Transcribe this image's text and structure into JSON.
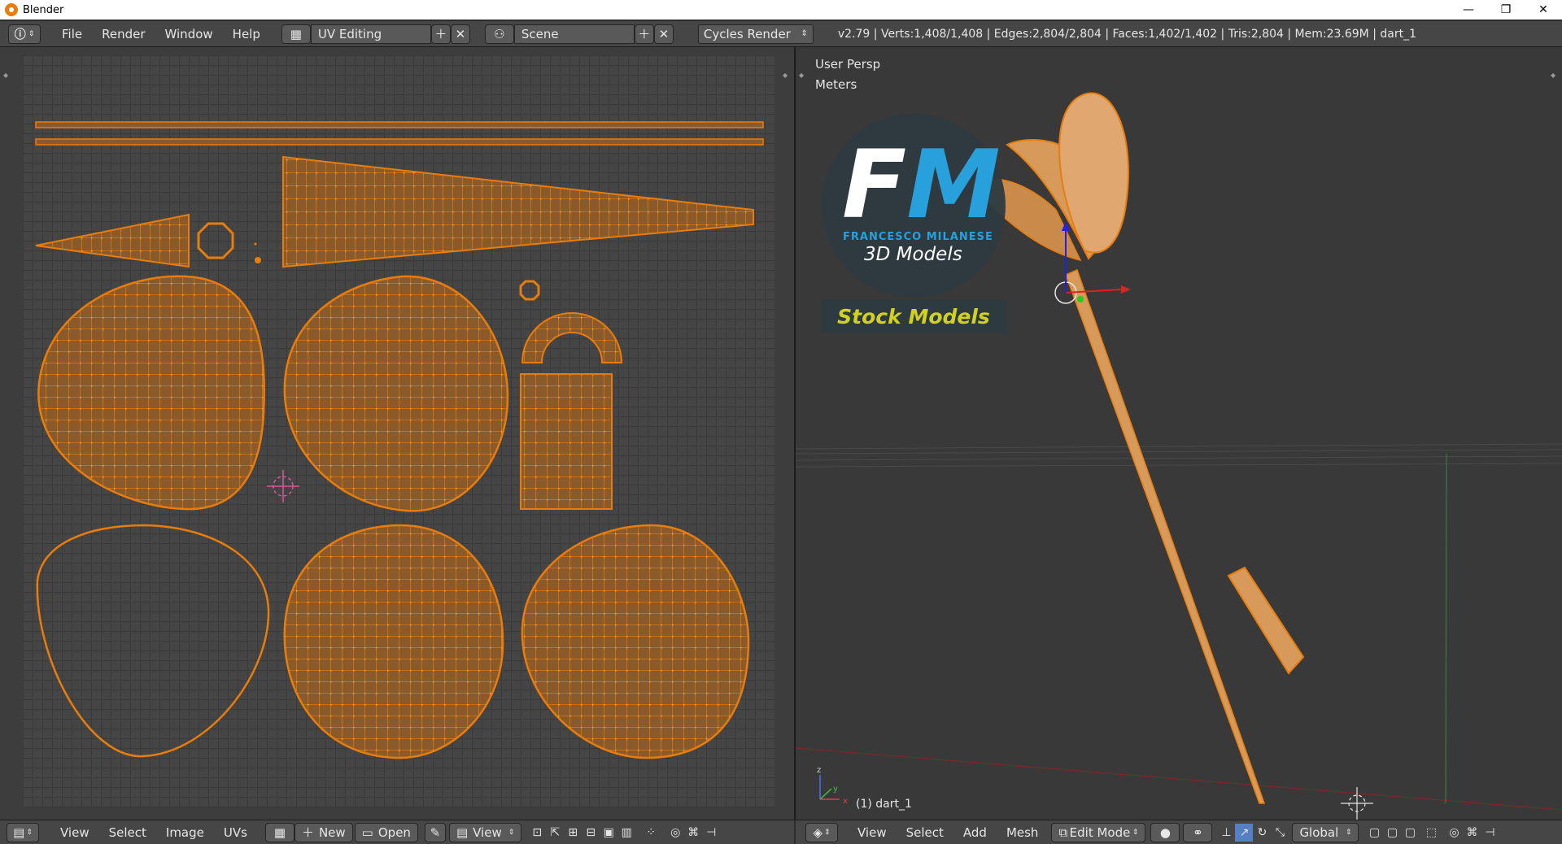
{
  "window": {
    "title": "Blender",
    "minimize": "—",
    "maximize": "❐",
    "close": "✕"
  },
  "info_header": {
    "menus": [
      "File",
      "Render",
      "Window",
      "Help"
    ],
    "screen_layout": "UV Editing",
    "scene": "Scene",
    "render_engine": "Cycles Render",
    "stats": "v2.79 | Verts:1,408/1,408 | Edges:2,804/2,804 | Faces:1,402/1,402 | Tris:2,804 | Mem:23.69M | dart_1"
  },
  "uv_editor": {
    "menus": [
      "View",
      "Select",
      "Image",
      "UVs"
    ],
    "new_label": "New",
    "open_label": "Open",
    "view_label": "View"
  },
  "viewport": {
    "view_name": "User Persp",
    "units": "Meters",
    "object_label": "(1) dart_1",
    "menus": [
      "View",
      "Select",
      "Add",
      "Mesh"
    ],
    "mode": "Edit Mode",
    "orientation": "Global"
  },
  "watermark": {
    "fm_f": "F",
    "fm_m": "M",
    "name": "FRANCESCO MILANESE",
    "subtitle": "3D Models",
    "banner": "Stock Models"
  },
  "colors": {
    "accent_orange": "#e87d0d",
    "mesh_fill": "#8a5a2a",
    "logo_blue": "#27a0db",
    "banner_yellow": "#d1d11f"
  }
}
